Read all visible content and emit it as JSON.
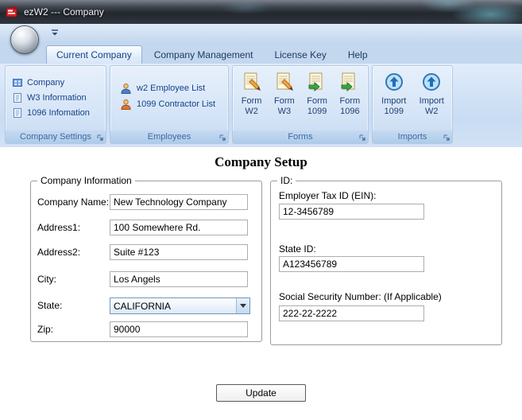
{
  "window": {
    "title": "ezW2 --- Company"
  },
  "tabs": [
    {
      "label": "Current Company"
    },
    {
      "label": "Company Management"
    },
    {
      "label": "License Key"
    },
    {
      "label": "Help"
    }
  ],
  "ribbon": {
    "company_settings": {
      "label": "Company Settings",
      "items": [
        {
          "label": "Company"
        },
        {
          "label": "W3 Information"
        },
        {
          "label": "1096 Infomation"
        }
      ]
    },
    "employees": {
      "label": "Employees",
      "items": [
        {
          "label": "w2 Employee List"
        },
        {
          "label": "1099 Contractor List"
        }
      ]
    },
    "forms": {
      "label": "Forms",
      "items": [
        {
          "line1": "Form",
          "line2": "W2"
        },
        {
          "line1": "Form",
          "line2": "W3"
        },
        {
          "line1": "Form",
          "line2": "1099"
        },
        {
          "line1": "Form",
          "line2": "1096"
        }
      ]
    },
    "imports": {
      "label": "Imports",
      "items": [
        {
          "line1": "Import",
          "line2": "1099"
        },
        {
          "line1": "Import",
          "line2": "W2"
        }
      ]
    }
  },
  "main": {
    "title": "Company Setup",
    "company_info": {
      "legend": "Company Information",
      "company_name": {
        "label": "Company Name:",
        "value": "New Technology Company"
      },
      "address1": {
        "label": "Address1:",
        "value": "100 Somewhere Rd."
      },
      "address2": {
        "label": "Address2:",
        "value": "Suite #123"
      },
      "city": {
        "label": "City:",
        "value": "Los Angels"
      },
      "state": {
        "label": "State:",
        "value": "CALIFORNIA"
      },
      "zip": {
        "label": "Zip:",
        "value": "90000"
      }
    },
    "id_info": {
      "legend": "ID:",
      "ein": {
        "label": "Employer Tax ID (EIN):",
        "value": "12-3456789"
      },
      "state_id": {
        "label": "State ID:",
        "value": "A123456789"
      },
      "ssn": {
        "label": "Social Security Number: (If Applicable)",
        "value": "222-22-2222"
      }
    },
    "update_button": "Update"
  },
  "colors": {
    "ribbon_accent": "#15428b",
    "group_label_text": "#3e6aa0"
  }
}
